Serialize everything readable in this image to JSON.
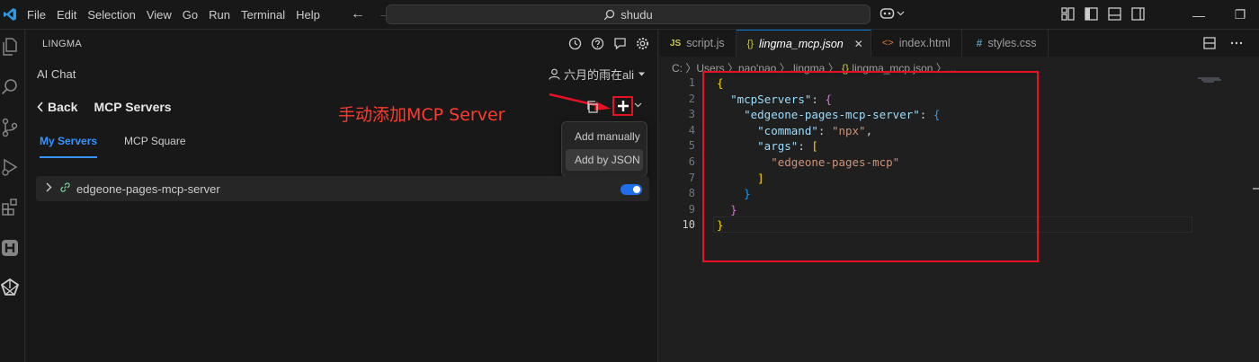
{
  "titlebar": {
    "menu": [
      "File",
      "Edit",
      "Selection",
      "View",
      "Go",
      "Run",
      "Terminal",
      "Help"
    ],
    "search": "shudu",
    "window_controls": [
      "—",
      "❐",
      "✕"
    ]
  },
  "panel": {
    "title": "LINGMA",
    "ai_chat": "AI Chat",
    "user": "六月的雨在ali",
    "back_label": "Back",
    "section_title": "MCP Servers",
    "annotation": "手动添加MCP Server",
    "dropdown": [
      "Add manually",
      "Add by JSON"
    ],
    "tabs": [
      "My Servers",
      "MCP Square"
    ],
    "server": {
      "name": "edgeone-pages-mcp-server",
      "enabled": true
    }
  },
  "editor": {
    "tabs": [
      {
        "icon": "JS",
        "label": "script.js"
      },
      {
        "icon": "{}",
        "label": "lingma_mcp.json",
        "active": true
      },
      {
        "icon": "<>",
        "label": "index.html"
      },
      {
        "icon": "#",
        "label": "styles.css"
      }
    ],
    "breadcrumb": {
      "path": "C: 〉Users 〉nao'nao 〉.lingma 〉",
      "json_icon": "{}",
      "file": " lingma_mcp.json 〉..."
    },
    "line_numbers": [
      "1",
      "2",
      "3",
      "4",
      "5",
      "6",
      "7",
      "8",
      "9",
      "10"
    ],
    "code": {
      "l1": "{",
      "l2_key": "\"mcpServers\"",
      "l2_rest": ": ",
      "l2_brace": "{",
      "l3_key": "\"edgeone-pages-mcp-server\"",
      "l3_rest": ": ",
      "l3_brace": "{",
      "l4_key": "\"command\"",
      "l4_rest": ": ",
      "l4_val": "\"npx\"",
      "l4_end": ",",
      "l5_key": "\"args\"",
      "l5_rest": ": ",
      "l5_brace": "[",
      "l6_val": "\"edgeone-pages-mcp\"",
      "l7": "]",
      "l8": "}",
      "l9": "}",
      "l10": "}"
    }
  },
  "colors": {
    "accent": "#0078d4",
    "annotation_red": "#e81123",
    "toggle_blue": "#1f6feb"
  },
  "icons": {
    "activity": [
      "explorer-icon",
      "search-icon",
      "source-control-icon",
      "run-debug-icon",
      "extensions-icon",
      "h-icon",
      "lingma-icon"
    ],
    "panel_actions": [
      "history-icon",
      "help-icon",
      "feedback-icon",
      "settings-icon"
    ]
  }
}
